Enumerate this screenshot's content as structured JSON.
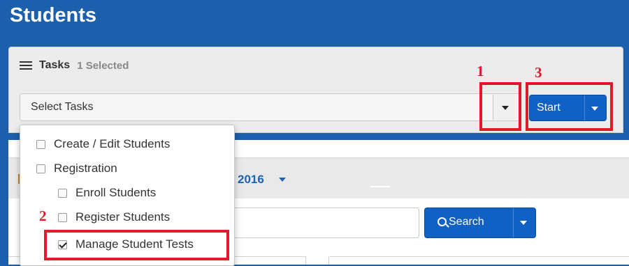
{
  "page": {
    "title": "Students"
  },
  "tasks": {
    "label": "Tasks",
    "selected_count": "1 Selected",
    "select_placeholder": "Select Tasks",
    "start_label": "Start"
  },
  "task_menu": {
    "items": [
      {
        "label": "Create / Edit Students",
        "checked": false
      },
      {
        "label": "Registration",
        "checked": false
      },
      {
        "label": "Enroll Students",
        "checked": false
      },
      {
        "label": "Register Students",
        "checked": false
      },
      {
        "label": "Manage Student Tests",
        "checked": true
      }
    ]
  },
  "filters": {
    "year_fragment": "2016"
  },
  "search": {
    "button_label": "Search"
  },
  "annotations": {
    "step1": "1",
    "step2": "2",
    "step3": "3",
    "color": "#e0192c"
  }
}
